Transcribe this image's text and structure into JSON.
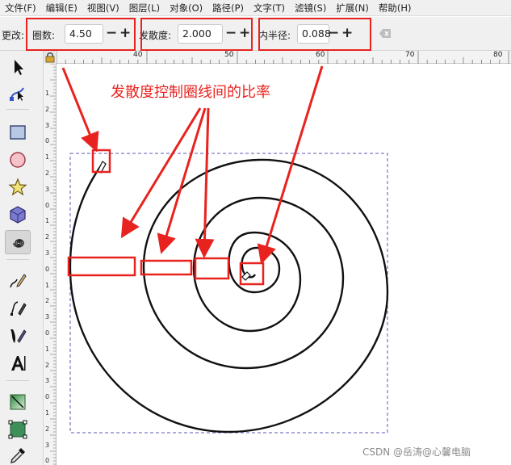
{
  "menu": [
    {
      "label": "文件(F)"
    },
    {
      "label": "编辑(E)"
    },
    {
      "label": "视图(V)"
    },
    {
      "label": "图层(L)"
    },
    {
      "label": "对象(O)"
    },
    {
      "label": "路径(P)"
    },
    {
      "label": "文字(T)"
    },
    {
      "label": "滤镜(S)"
    },
    {
      "label": "扩展(N)"
    },
    {
      "label": "帮助(H)"
    }
  ],
  "controls": {
    "change_label": "更改:",
    "turns_label": "圈数:",
    "turns_value": "4.50",
    "divergence_label": "发散度:",
    "divergence_value": "2.000",
    "inner_radius_label": "内半径:",
    "inner_radius_value": "0.088",
    "minus": "−",
    "plus": "+"
  },
  "ruler": {
    "h_ticks": [
      {
        "label": "40"
      },
      {
        "label": "50"
      },
      {
        "label": "60"
      },
      {
        "label": "70"
      },
      {
        "label": "80"
      }
    ],
    "v_ticks": [
      "1",
      "2",
      "3",
      "0",
      "1",
      "2",
      "3",
      "0",
      "1",
      "2",
      "3",
      "0",
      "1",
      "2",
      "3",
      "0",
      "1",
      "2",
      "3",
      "0",
      "1",
      "2",
      "3",
      "0"
    ]
  },
  "tools": [
    {
      "name": "selector-tool"
    },
    {
      "name": "node-tool"
    },
    {
      "name": "rectangle-tool"
    },
    {
      "name": "ellipse-tool"
    },
    {
      "name": "star-tool"
    },
    {
      "name": "3dbox-tool"
    },
    {
      "name": "spiral-tool",
      "active": true
    },
    {
      "name": "pencil-tool"
    },
    {
      "name": "pen-tool"
    },
    {
      "name": "calligraphy-tool"
    },
    {
      "name": "text-tool"
    },
    {
      "name": "gradient-tool"
    },
    {
      "name": "mesh-tool"
    },
    {
      "name": "dropper-tool"
    }
  ],
  "annotation": "发散度控制圈线间的比率",
  "watermark": "CSDN @岳涛@心馨电脑",
  "colors": {
    "annotation": "#e8231f",
    "selection": "#5a5ab4"
  }
}
